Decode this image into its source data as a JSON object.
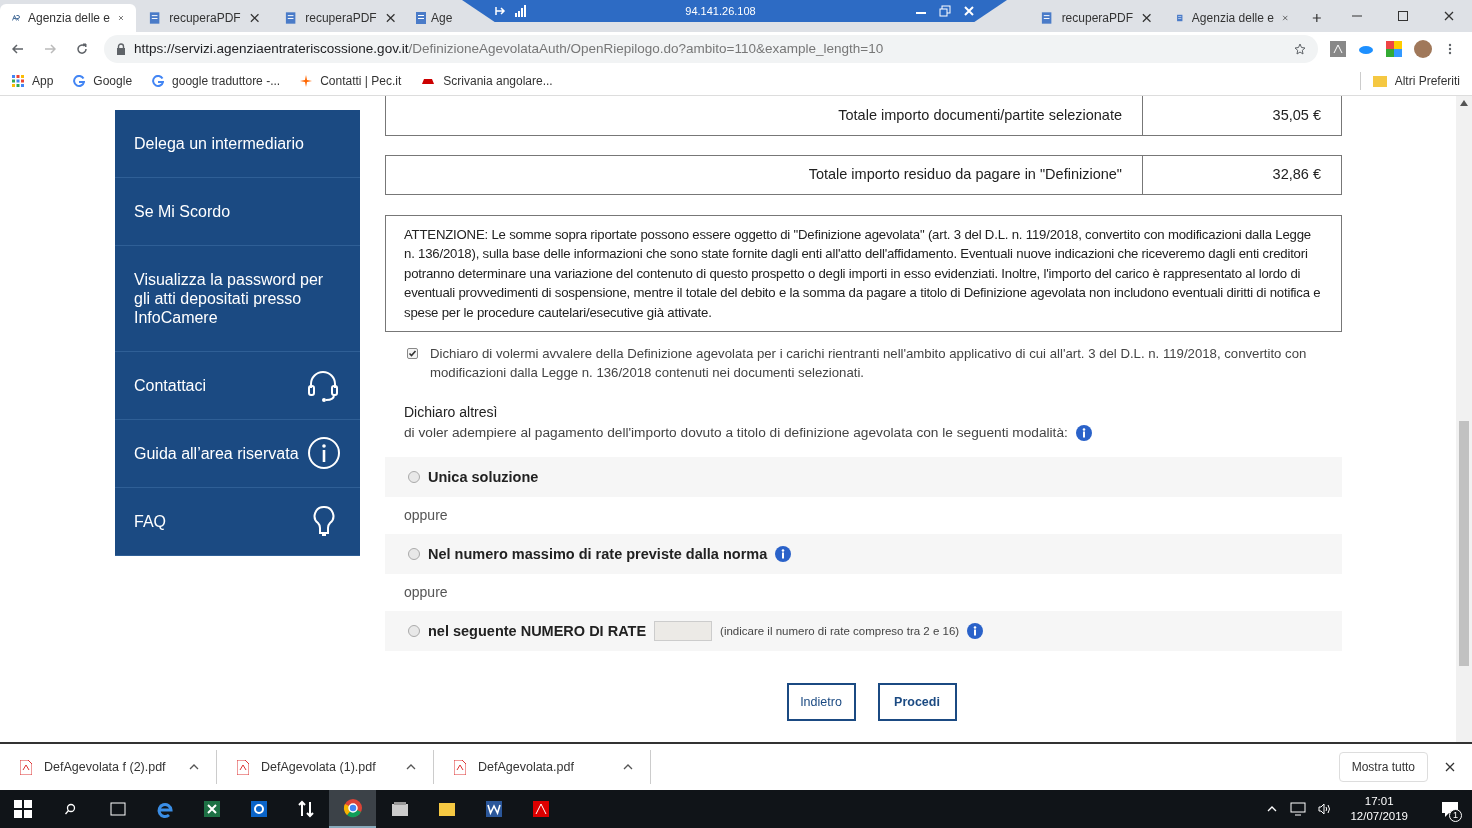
{
  "browser": {
    "tabs": [
      {
        "title": "Agenzia delle e",
        "kind": "site",
        "selected": true
      },
      {
        "title": "recuperaPDF",
        "kind": "doc",
        "selected": false
      },
      {
        "title": "recuperaPDF",
        "kind": "doc",
        "selected": false
      },
      {
        "title": "Age",
        "kind": "doc",
        "selected": false
      },
      {
        "title": "recuperaPDF",
        "kind": "doc",
        "selected": false
      },
      {
        "title": "Agenzia delle e",
        "kind": "doc",
        "selected": false
      }
    ],
    "remote_bar": {
      "address": "94.141.26.108"
    },
    "url": {
      "host": "https://servizi.agenziaentrateriscossione.gov.it",
      "path": "/DefinizioneAgevolataAuth/OpenRiepilogo.do?ambito=110&example_length=10"
    },
    "bookmarks": [
      {
        "label": "App",
        "kind": "apps"
      },
      {
        "label": "Google",
        "kind": "google"
      },
      {
        "label": "google traduttore -...",
        "kind": "google"
      },
      {
        "label": "Contatti | Pec.it",
        "kind": "star"
      },
      {
        "label": "Scrivania angolare...",
        "kind": "car"
      }
    ],
    "other_bookmarks": "Altri Preferiti"
  },
  "sidebar": {
    "items": [
      {
        "label": "Delega un intermediario",
        "kind": "plain"
      },
      {
        "label": "Se Mi Scordo",
        "kind": "plain"
      },
      {
        "label": "Visualizza la password per gli atti depositati presso InfoCamere",
        "kind": "plain"
      },
      {
        "label": "Contattaci",
        "kind": "contact"
      },
      {
        "label": "Guida all’area riservata",
        "kind": "guide"
      },
      {
        "label": "FAQ",
        "kind": "faq"
      }
    ]
  },
  "totals": [
    {
      "label": "Totale importo documenti/partite selezionate",
      "value": "35,05 €"
    },
    {
      "label": "Totale importo residuo da pagare in \"Definizione\"",
      "value": "32,86 €"
    }
  ],
  "notice": "ATTENZIONE: Le somme sopra riportate possono essere oggetto di \"Definizione agevolata\" (art. 3 del D.L. n. 119/2018, convertito con modificazioni dalla Legge n. 136/2018), sulla base delle informazioni che sono state fornite dagli enti all'atto dell'affidamento. Eventuali nuove indicazioni che riceveremo dagli enti creditori potranno determinare una variazione del contenuto di questo prospetto o degli importi in esso evidenziati. Inoltre, l'importo del carico è rappresentato al lordo di eventuali provvedimenti di sospensione, mentre il totale del debito e la somma da pagare a titolo di Definizione agevolata non includono eventuali diritti di notifica e spese per le procedure cautelari/esecutive già attivate.",
  "declaration": {
    "checked": true,
    "text": "Dichiaro di volermi avvalere della Definizione agevolata per i carichi rientranti nell'ambito applicativo di cui all'art. 3 del D.L. n. 119/2018, convertito con modificazioni dalla Legge n. 136/2018 contenuti nei documenti selezionati."
  },
  "also": {
    "heading": "Dichiaro altresì",
    "text": "di voler adempiere al pagamento dell'importo dovuto a titolo di definizione agevolata con le seguenti modalità:"
  },
  "options": [
    {
      "kind": "plain",
      "label": "Unica soluzione",
      "selected": false
    },
    {
      "kind": "separator",
      "label": "oppure"
    },
    {
      "kind": "info",
      "label": "Nel numero massimo di rate previste dalla norma",
      "selected": false
    },
    {
      "kind": "separator",
      "label": "oppure"
    },
    {
      "kind": "input",
      "label": "nel seguente NUMERO DI RATE",
      "hint": "(indicare il numero di rate compreso tra 2 e 16)",
      "selected": false
    }
  ],
  "buttons": [
    "Indietro",
    "Procedi"
  ],
  "downloads": {
    "files": [
      "DefAgevolata f (2).pdf",
      "DefAgevolata (1).pdf",
      "DefAgevolata.pdf"
    ],
    "show_all": "Mostra tutto"
  },
  "taskbar": {
    "time": "17:01",
    "date": "12/07/2019",
    "notifications": "1"
  }
}
